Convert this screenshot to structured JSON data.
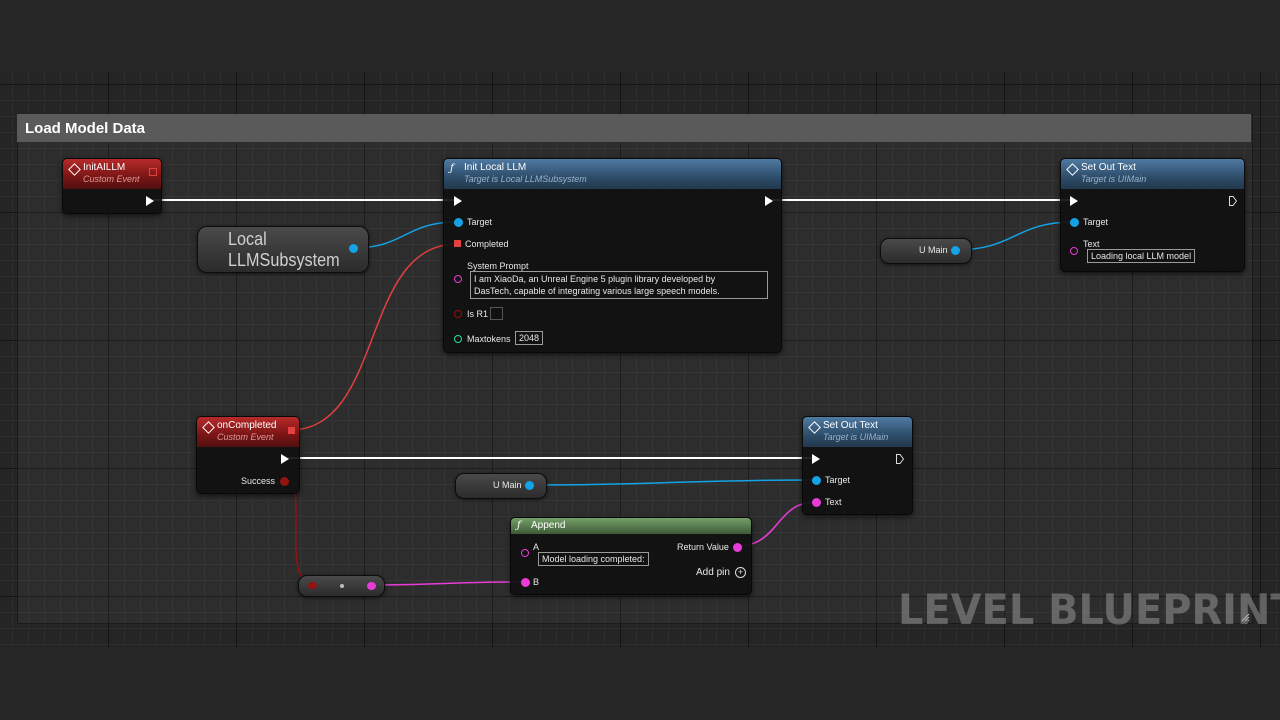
{
  "comment_title": "Load Model Data",
  "watermark": "LEVEL BLUEPRINT",
  "colors": {
    "exec": "#ffffff",
    "object_pin": "#13a3e6",
    "text_pin": "#e83cd8",
    "bool_pin": "#931212",
    "int_pin": "#1fe0a6",
    "delegate_pin": "#e34040",
    "event_header": "#8e1b1b",
    "function_header": "#3b5f82",
    "pure_header": "#5a7d52"
  },
  "nodes": {
    "init_event": {
      "title": "InitAILLM",
      "subtitle": "Custom Event"
    },
    "subsystem": {
      "label_line1": "Local",
      "label_line2": "LLMSubsystem"
    },
    "init_llm": {
      "title": "Init Local LLM",
      "subtitle": "Target is Local LLMSubsystem",
      "pins": {
        "target": "Target",
        "completed": "Completed",
        "system_prompt": "System Prompt",
        "system_prompt_value_line1": "I am XiaoDa, an Unreal Engine 5 plugin library developed by",
        "system_prompt_value_line2": "DasTech, capable of integrating various large speech models.",
        "is_r1": "Is R1",
        "maxtokens": "Maxtokens",
        "maxtokens_value": "2048"
      }
    },
    "set_text_1": {
      "title": "Set Out Text",
      "subtitle": "Target is UIMain",
      "pins": {
        "target": "Target",
        "text": "Text",
        "text_value": "Loading local LLM model"
      }
    },
    "umain_1": {
      "label": "U Main"
    },
    "on_completed": {
      "title": "onCompleted",
      "subtitle": "Custom Event",
      "pins": {
        "success": "Success"
      }
    },
    "set_text_2": {
      "title": "Set Out Text",
      "subtitle": "Target is UIMain",
      "pins": {
        "target": "Target",
        "text": "Text"
      }
    },
    "umain_2": {
      "label": "U Main"
    },
    "append": {
      "title": "Append",
      "pins": {
        "a": "A",
        "a_value": "Model loading completed:",
        "b": "B",
        "return_value": "Return Value",
        "add_pin": "Add pin"
      }
    }
  }
}
